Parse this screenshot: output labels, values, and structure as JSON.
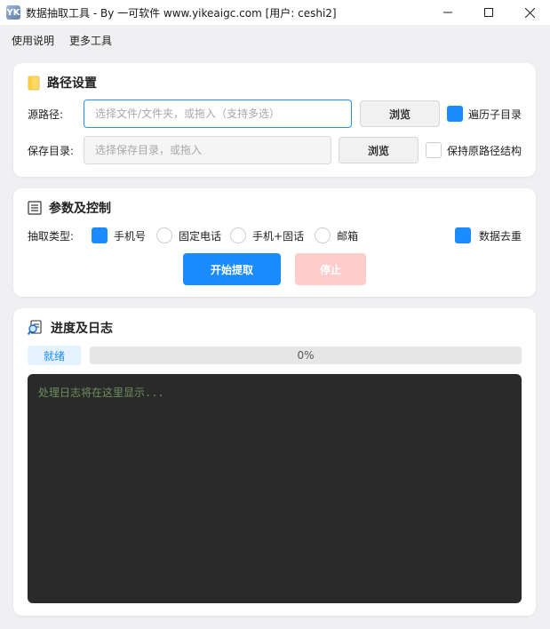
{
  "window": {
    "title": "数据抽取工具 - By 一可软件 www.yikeaigc.com [用户: ceshi2]",
    "app_icon_label": "YK",
    "minimize_symbol": "—",
    "maximize_symbol": "☐",
    "close_symbol": "✕"
  },
  "menu": {
    "items": [
      "使用说明",
      "更多工具"
    ]
  },
  "path_section": {
    "title": "路径设置",
    "icon": "folder-icon",
    "source_label": "源路径:",
    "source_placeholder": "选择文件/文件夹，或拖入（支持多选）",
    "source_value": "",
    "browse_label": "浏览",
    "recursive_label": "遍历子目录",
    "recursive_checked": true,
    "save_label": "保存目录:",
    "save_placeholder": "选择保存目录，或拖入",
    "save_value": "",
    "save_browse_label": "浏览",
    "keep_structure_label": "保持原路径结构",
    "keep_structure_checked": false
  },
  "params_section": {
    "title": "参数及控制",
    "icon": "document-list-icon",
    "type_label": "抽取类型:",
    "types": [
      {
        "label": "手机号",
        "selected": true
      },
      {
        "label": "固定电话",
        "selected": false
      },
      {
        "label": "手机+固话",
        "selected": false
      },
      {
        "label": "邮箱",
        "selected": false
      }
    ],
    "dedupe_label": "数据去重",
    "dedupe_checked": true,
    "start_label": "开始提取",
    "stop_label": "停止"
  },
  "progress_section": {
    "title": "进度及日志",
    "icon": "magnifier-document-icon",
    "status": "就绪",
    "progress_percent": 0,
    "progress_text": "0%",
    "log_placeholder": "处理日志将在这里显示..."
  },
  "colors": {
    "accent": "#1a8cff",
    "stop_disabled": "#ffcccc",
    "log_bg": "#2a2a2a",
    "log_text": "#6d8f5e"
  }
}
